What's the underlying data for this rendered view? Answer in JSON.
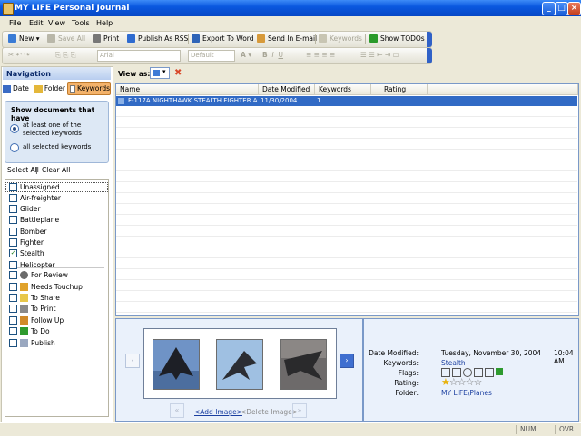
{
  "window": {
    "title": "MY LIFE Personal Journal"
  },
  "menu": [
    "File",
    "Edit",
    "View",
    "Tools",
    "Help"
  ],
  "toolbar": {
    "new": "New",
    "save_all": "Save All",
    "print": "Print",
    "publish_rss": "Publish As RSS",
    "export_word": "Export To Word",
    "send_email": "Send In E-mail",
    "keywords": "Keywords",
    "show_todos": "Show TODOs"
  },
  "format_toolbar": {
    "font": "Arial",
    "size": "Default"
  },
  "navigation": {
    "title": "Navigation",
    "tabs": [
      "Date",
      "Folder",
      "Keywords"
    ],
    "show_heading": "Show documents that have",
    "option_any": "at least one of the selected keywords",
    "option_all": "all selected keywords",
    "select_all": "Select All",
    "clear_all": "Clear All",
    "keywords": [
      {
        "label": "Unassigned",
        "checked": false
      },
      {
        "label": "Air-freighter",
        "checked": false
      },
      {
        "label": "Glider",
        "checked": false
      },
      {
        "label": "Battleplane",
        "checked": false
      },
      {
        "label": "Bomber",
        "checked": false
      },
      {
        "label": "Fighter",
        "checked": false
      },
      {
        "label": "Stealth",
        "checked": true
      },
      {
        "label": "Helicopter",
        "checked": false
      },
      {
        "label": "For Review",
        "checked": false
      },
      {
        "label": "Needs Touchup",
        "checked": false
      },
      {
        "label": "To Share",
        "checked": false
      },
      {
        "label": "To Print",
        "checked": false
      },
      {
        "label": "Follow Up",
        "checked": false
      },
      {
        "label": "To Do",
        "checked": false
      },
      {
        "label": "Publish",
        "checked": false
      }
    ]
  },
  "view": {
    "label": "View as:"
  },
  "grid": {
    "columns": [
      "Name",
      "Date Modified",
      "Keywords",
      "Rating"
    ],
    "rows": [
      {
        "name": "F-117A NIGHTHAWK STEALTH FIGHTER A...",
        "date": "11/30/2004",
        "keywords": "1",
        "rating": ""
      }
    ]
  },
  "preview": {
    "add_image": "<Add Image>",
    "delete_image": "<Delete Image>"
  },
  "details": {
    "date_label": "Date Modified:",
    "date_value": "Tuesday, November 30, 2004",
    "time_value": "10:04 AM",
    "keywords_label": "Keywords:",
    "keywords_value": "Stealth",
    "flags_label": "Flags:",
    "rating_label": "Rating:",
    "rating_value": 1,
    "rating_max": 5,
    "folder_label": "Folder:",
    "folder_value": "MY LIFE\\Planes"
  },
  "status": {
    "num": "NUM",
    "ovr": "OVR"
  }
}
